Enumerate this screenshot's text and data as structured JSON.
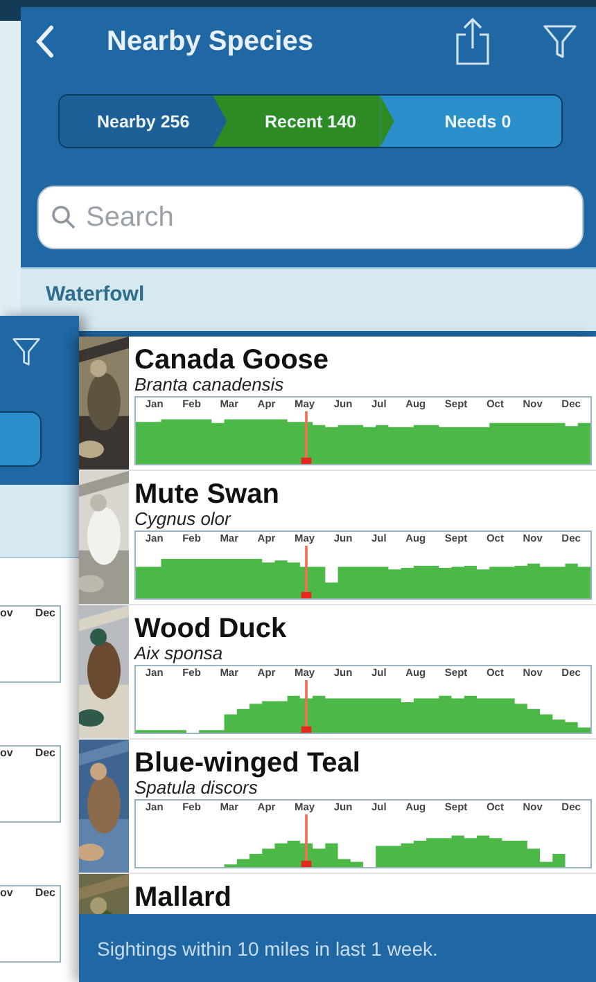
{
  "header": {
    "title": "Nearby Species"
  },
  "tabs": [
    {
      "label": "Nearby 256",
      "selected": false
    },
    {
      "label": "Recent 140",
      "selected": true
    },
    {
      "label": "Needs 0",
      "selected": false
    }
  ],
  "search": {
    "placeholder": "Search"
  },
  "section": {
    "title": "Waterfowl"
  },
  "species": [
    {
      "name": "Canada Goose",
      "scientific_name": "Branta canadensis",
      "months": [
        "Jan",
        "Feb",
        "Mar",
        "Apr",
        "May",
        "Jun",
        "Jul",
        "Aug",
        "Sept",
        "Oct",
        "Nov",
        "Dec"
      ]
    },
    {
      "name": "Mute Swan",
      "scientific_name": "Cygnus olor",
      "months": [
        "Jan",
        "Feb",
        "Mar",
        "Apr",
        "May",
        "Jun",
        "Jul",
        "Aug",
        "Sept",
        "Oct",
        "Nov",
        "Dec"
      ]
    },
    {
      "name": "Wood Duck",
      "scientific_name": "Aix sponsa",
      "months": [
        "Jan",
        "Feb",
        "Mar",
        "Apr",
        "May",
        "Jun",
        "Jul",
        "Aug",
        "Sept",
        "Oct",
        "Nov",
        "Dec"
      ]
    },
    {
      "name": "Blue-winged Teal",
      "scientific_name": "Spatula discors",
      "months": [
        "Jan",
        "Feb",
        "Mar",
        "Apr",
        "May",
        "Jun",
        "Jul",
        "Aug",
        "Sept",
        "Oct",
        "Nov",
        "Dec"
      ]
    },
    {
      "name": "Mallard"
    }
  ],
  "footer": "Sightings within 10 miles in last 1 week.",
  "back_screen": {
    "chart_labels": [
      [
        "ov",
        "Dec"
      ],
      [
        "ov",
        "Dec"
      ],
      [
        "ov",
        "Dec"
      ]
    ]
  }
}
